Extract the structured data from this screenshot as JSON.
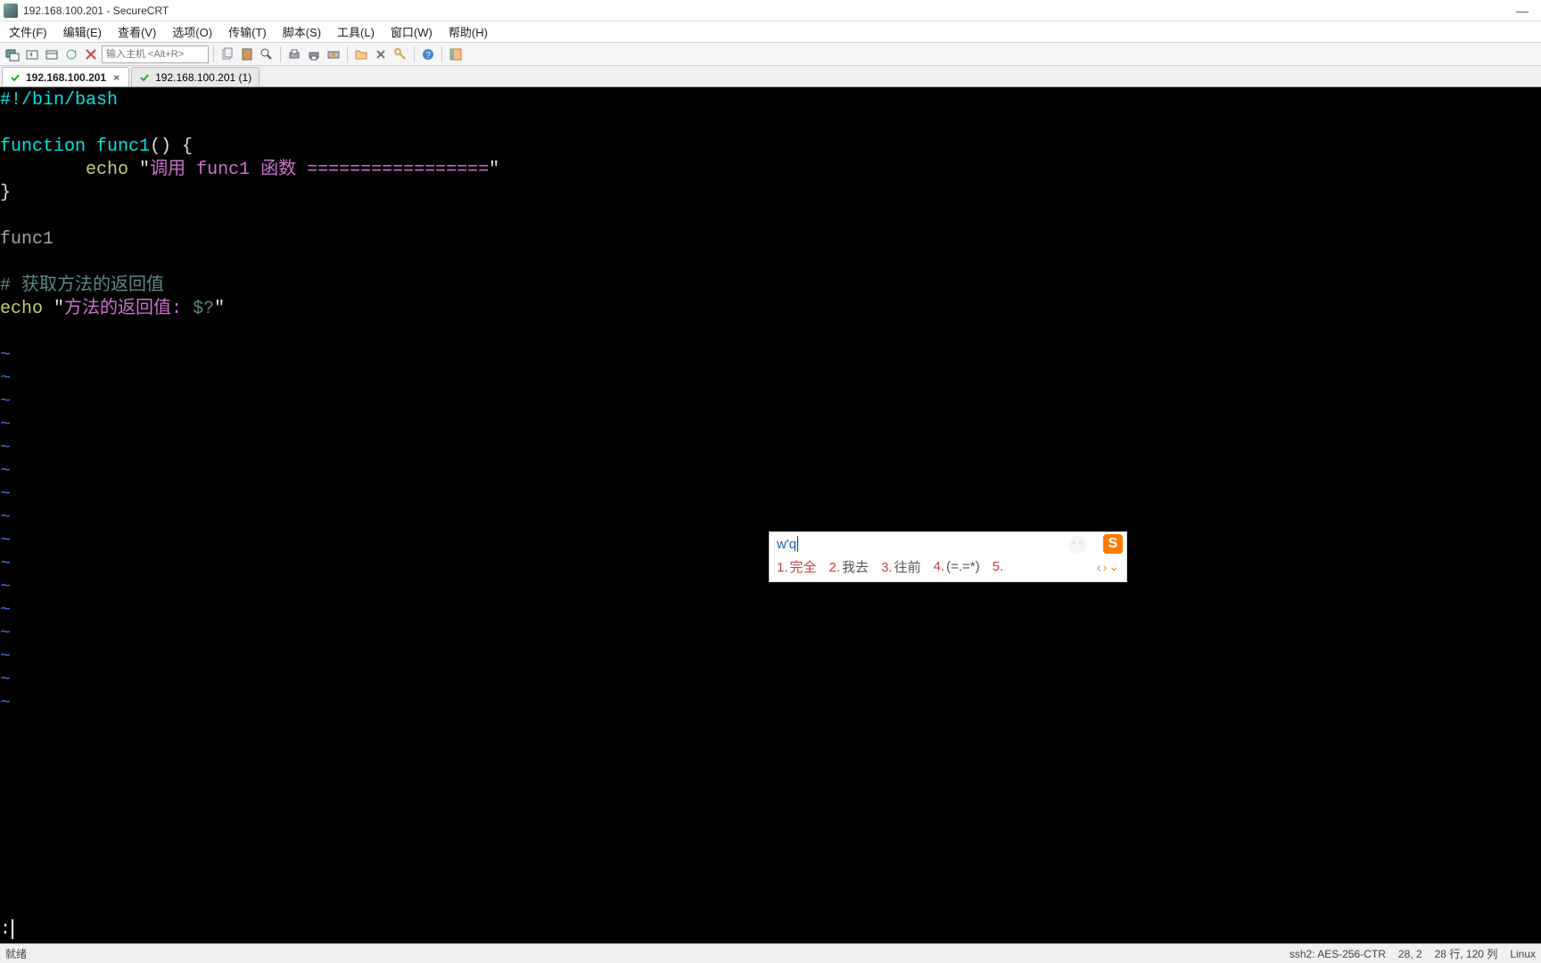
{
  "window": {
    "title": "192.168.100.201 - SecureCRT"
  },
  "menu": {
    "items": [
      "文件(F)",
      "编辑(E)",
      "查看(V)",
      "选项(O)",
      "传输(T)",
      "脚本(S)",
      "工具(L)",
      "窗口(W)",
      "帮助(H)"
    ]
  },
  "toolbar": {
    "host_placeholder": "输入主机 <Alt+R>"
  },
  "tabs": {
    "items": [
      {
        "label": "192.168.100.201",
        "active": true,
        "closable": true
      },
      {
        "label": "192.168.100.201 (1)",
        "active": false,
        "closable": false
      }
    ]
  },
  "terminal": {
    "shebang": "#!/bin/bash",
    "func_decl_pre": "function ",
    "func_decl_name": "func1",
    "func_decl_post": "() {",
    "echo_kw": "echo",
    "echo_body_str1": "调用 ",
    "echo_body_func": "func1",
    "echo_body_str2": " 函数 ",
    "echo_body_eq": "=================",
    "brace_close": "}",
    "call_line": "func1",
    "comment_prefix": "# ",
    "comment_text": "获取方法的返回值",
    "echo2_pre": "方法的返回值: ",
    "echo2_var": "$?",
    "tilde": "~",
    "prompt": ":"
  },
  "ime": {
    "typed": "w'q",
    "logo_letter": "S",
    "candidates": [
      {
        "num": "1.",
        "txt": "完全"
      },
      {
        "num": "2.",
        "txt": "我去"
      },
      {
        "num": "3.",
        "txt": "往前"
      },
      {
        "num": "4.",
        "txt": "(=.=*)"
      },
      {
        "num": "5.",
        "txt": ""
      }
    ]
  },
  "status": {
    "left": "就绪",
    "ssh": "ssh2: AES-256-CTR",
    "pos": "28,   2",
    "dims": "28 行, 120 列",
    "os": "Linux"
  }
}
